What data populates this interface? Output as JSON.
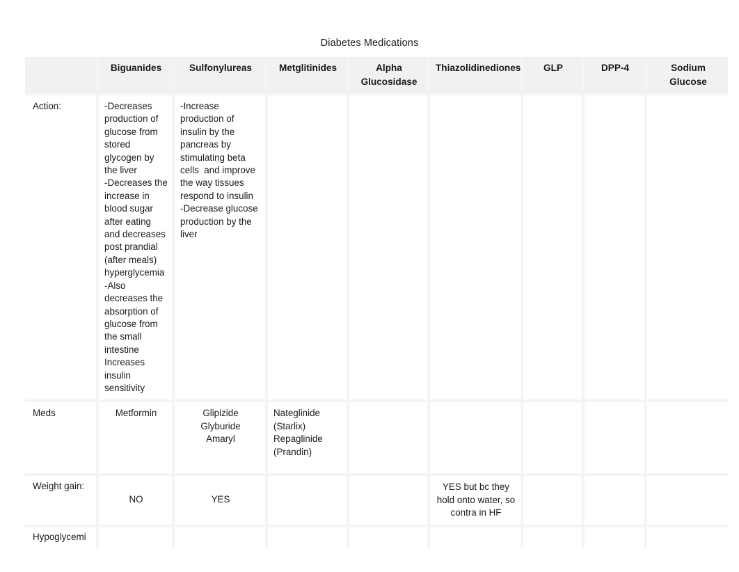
{
  "document": {
    "title": "Diabetes Medications"
  },
  "table": {
    "columns": [
      {
        "key": "rowlabel",
        "header": ""
      },
      {
        "key": "biguanides",
        "header": "Biguanides"
      },
      {
        "key": "sulfonylureas",
        "header": "Sulfonylureas"
      },
      {
        "key": "metglitinides",
        "header": "Metglitinides"
      },
      {
        "key": "alpha_glucosidase",
        "header": "Alpha Glucosidase"
      },
      {
        "key": "thiazolidinediones",
        "header": "Thiazolidinediones"
      },
      {
        "key": "glp",
        "header": "GLP"
      },
      {
        "key": "dpp4",
        "header": "DPP-4"
      },
      {
        "key": "sodium_glucose",
        "header": "Sodium Glucose"
      }
    ],
    "rows": [
      {
        "name": "action",
        "label": "Action:",
        "cells": {
          "biguanides": "-Decreases production of glucose from stored glycogen by the liver\n-Decreases the increase in blood sugar after eating and decreases post prandial (after meals) hyperglycemia\n-Also decreases the absorption of glucose from the small intestine\nIncreases insulin sensitivity",
          "sulfonylureas": "-Increase production of insulin by the pancreas by stimulating beta cells  and improve the way tissues respond to insulin\n-Decrease glucose production by the liver",
          "metglitinides": "",
          "alpha_glucosidase": "",
          "thiazolidinediones": "",
          "glp": "",
          "dpp4": "",
          "sodium_glucose": ""
        }
      },
      {
        "name": "meds",
        "label": "Meds",
        "cells": {
          "biguanides": "Metformin",
          "sulfonylureas": "Glipizide\nGlyburide\nAmaryl",
          "metglitinides": "Nateglinide (Starlix) Repaglinide (Prandin)",
          "alpha_glucosidase": "",
          "thiazolidinediones": "",
          "glp": "",
          "dpp4": "",
          "sodium_glucose": ""
        }
      },
      {
        "name": "weight-gain",
        "label": "Weight gain:",
        "cells": {
          "biguanides": "NO",
          "sulfonylureas": "YES",
          "metglitinides": "",
          "alpha_glucosidase": "",
          "thiazolidinediones": "YES but bc they hold onto water, so contra in HF",
          "glp": "",
          "dpp4": "",
          "sodium_glucose": ""
        }
      },
      {
        "name": "hypoglycemia",
        "label": "Hypoglycemi",
        "cells": {
          "biguanides": "",
          "sulfonylureas": "",
          "metglitinides": "",
          "alpha_glucosidase": "",
          "thiazolidinediones": "",
          "glp": "",
          "dpp4": "",
          "sodium_glucose": ""
        }
      }
    ]
  },
  "colors": {
    "page_background": "#ffffff",
    "cell_background": "#ffffff",
    "gridline": "#f4f4f4",
    "header_background": "#f1f1f1",
    "text": "#1a1a1a"
  }
}
